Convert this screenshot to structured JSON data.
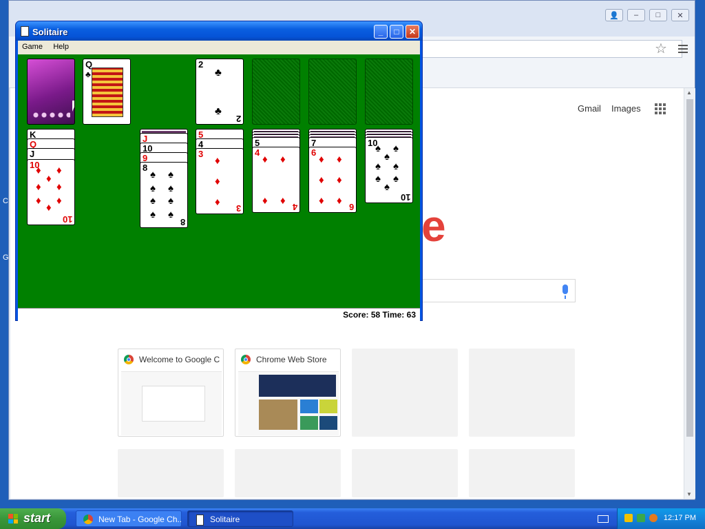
{
  "desktop": {
    "label_1": "C",
    "label_2": "Go"
  },
  "chrome": {
    "ntp": {
      "gmail": "Gmail",
      "images": "Images",
      "logo_fragment": "e",
      "tiles": [
        {
          "title": "Welcome to Google C"
        },
        {
          "title": "Chrome Web Store"
        },
        {
          "title": ""
        },
        {
          "title": ""
        },
        {
          "title": ""
        },
        {
          "title": ""
        },
        {
          "title": ""
        },
        {
          "title": ""
        }
      ]
    },
    "window_controls": {
      "user": "👤",
      "minimize": "–",
      "maximize": "□",
      "close": "✕"
    }
  },
  "solitaire": {
    "title": "Solitaire",
    "menu": [
      "Game",
      "Help"
    ],
    "status": "Score: 58 Time: 63",
    "controls": {
      "minimize": "_",
      "maximize": "□",
      "close": "✕"
    },
    "waste": {
      "rank": "Q",
      "suit": "♣"
    },
    "foundations": [
      {
        "rank": "2",
        "suit": "♣",
        "color": "black"
      },
      {
        "rank": "",
        "suit": ""
      },
      {
        "rank": "",
        "suit": ""
      },
      {
        "rank": "",
        "suit": ""
      }
    ],
    "tableau": [
      {
        "visible": [
          "K♠",
          "Q♥",
          "J♠"
        ],
        "top": {
          "rank": "10",
          "suit": "♦",
          "color": "red"
        }
      },
      {
        "visible": [],
        "top": null
      },
      {
        "visible": [
          "J♥",
          "10♠",
          "9♥"
        ],
        "top": {
          "rank": "8",
          "suit": "♠",
          "color": "black"
        }
      },
      {
        "visible": [
          "5♥",
          "4♠"
        ],
        "top": {
          "rank": "3",
          "suit": "♦",
          "color": "red"
        }
      },
      {
        "visible": [
          "5♠"
        ],
        "top": {
          "rank": "4",
          "suit": "♦",
          "color": "red"
        }
      },
      {
        "visible": [
          "7♠"
        ],
        "top": {
          "rank": "6",
          "suit": "♦",
          "color": "red"
        }
      },
      {
        "visible": [],
        "top": {
          "rank": "10",
          "suit": "♠",
          "color": "black"
        }
      }
    ]
  },
  "taskbar": {
    "start": "start",
    "buttons": [
      {
        "label": "New Tab - Google Ch..."
      },
      {
        "label": "Solitaire"
      }
    ],
    "clock": "12:17 PM"
  }
}
